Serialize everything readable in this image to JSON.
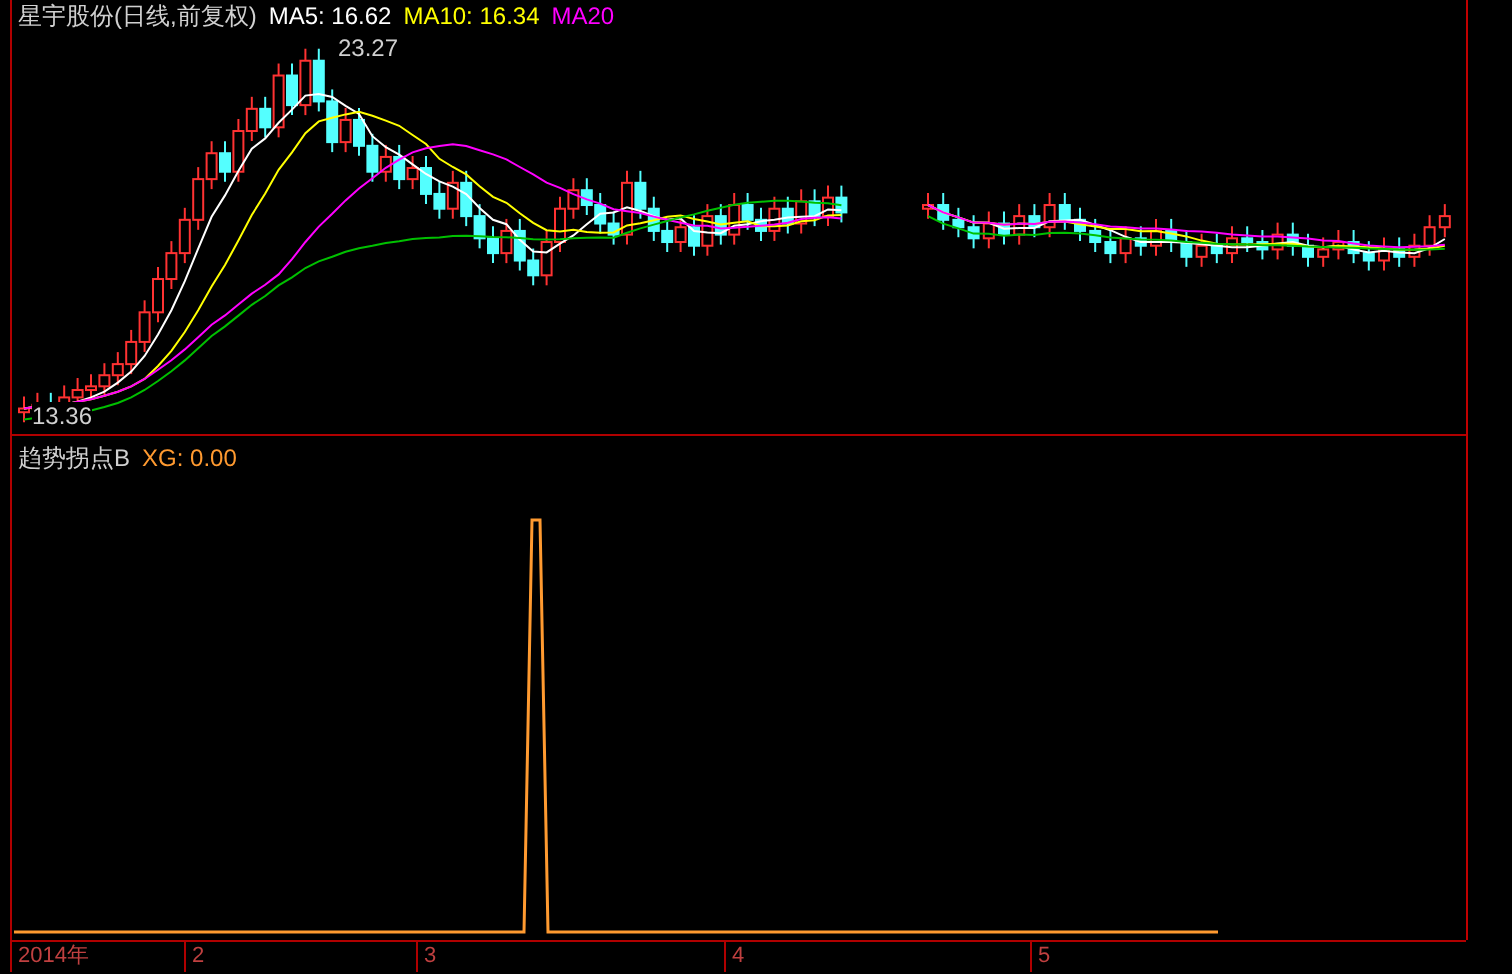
{
  "chart_title": "星宇股份(日线,前复权)",
  "ma_legend": [
    {
      "label": "MA5: 16.62",
      "color": "#ffffff"
    },
    {
      "label": "MA10: 16.34",
      "color": "#ffff00"
    },
    {
      "label": "MA20",
      "color": "#ff00ff"
    }
  ],
  "high_label": "23.27",
  "low_label": "13.36",
  "indicator": {
    "name": "趋势拐点B",
    "value": "XG: 0.00"
  },
  "time_axis": [
    "2014年",
    "2",
    "3",
    "4",
    "5"
  ]
}
